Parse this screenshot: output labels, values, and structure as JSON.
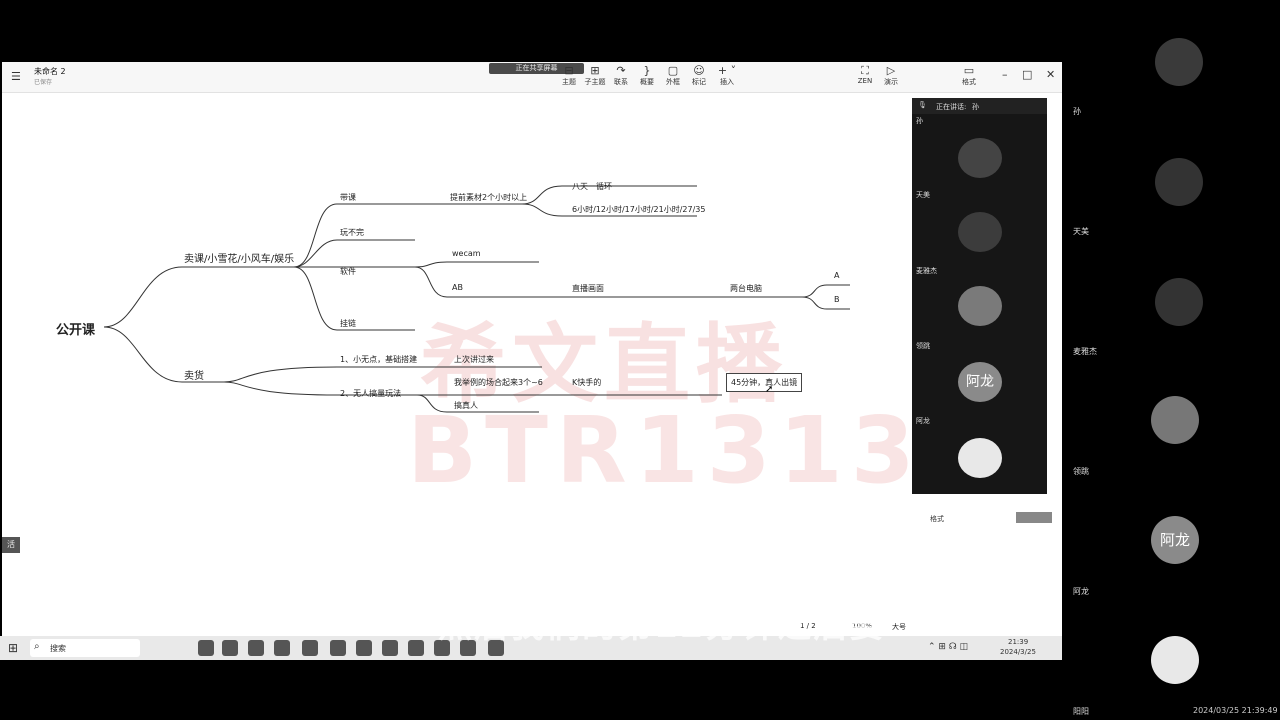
{
  "app": {
    "doc_title": "未命名 2",
    "doc_subtitle": "已保存",
    "share_banner": "正在共享屏幕",
    "toolbar": [
      "主题",
      "子主题",
      "联系",
      "概要",
      "外框",
      "标记",
      "插入"
    ],
    "zen": "ZEN",
    "present": "演示",
    "panel_label": "格式"
  },
  "mindmap": {
    "root": "公开课",
    "branch1": "卖课/小雪花/小风车/娱乐",
    "branch2": "卖货",
    "b1_children": [
      "带课",
      "玩不完",
      "软件",
      "挂链"
    ],
    "dai_ke_note": "提前素材2个小时以上",
    "eight_hour": "八天一循环",
    "hours_list": "6小时/12小时/17小时/21小时/27/35",
    "software_1": "wecam",
    "software_2": "AB",
    "direct": "直播画面",
    "two_pc": "两台电脑",
    "a_label": "A",
    "b_label": "B",
    "b2_children": [
      "1、小无点，基础搭建",
      "2、无人搞量玩法"
    ],
    "upload": "上次讲过来",
    "sample": "我举例的场合起来3个~6",
    "k_hand": "K快手的",
    "hand_person": "搞真人",
    "callout": "45分钟，真人出镜"
  },
  "watermark": {
    "line1": "希文直播",
    "line2": "BTR1313"
  },
  "side_panel": {
    "header_a": "正在讲话:",
    "header_b": "孙",
    "names": [
      "孙",
      "天美",
      "麦雅杰",
      "领跳",
      "阿龙"
    ],
    "avatar_text": "阿龙"
  },
  "statusbar": {
    "zoom": "100%",
    "page": "1 / 2",
    "size": "大号"
  },
  "taskbar": {
    "search": "搜索",
    "time": "21:39",
    "date": "2024/3/25"
  },
  "right_column": {
    "names": [
      "孙",
      "天美",
      "麦雅杰",
      "领跳",
      "阿龙",
      "阳阳"
    ],
    "avatar_text": "阿龙",
    "timestamp": "2024/03/25 21:39:49"
  },
  "subtitle": "然后我们的第12分钟之后要",
  "left_tab": "活"
}
